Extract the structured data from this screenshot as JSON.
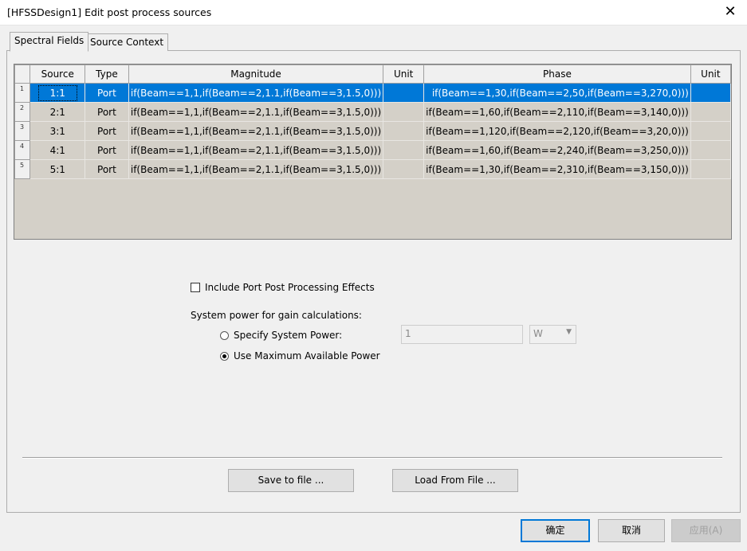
{
  "window": {
    "title": "[HFSSDesign1]  Edit post process sources",
    "close": "✕"
  },
  "tabs": [
    {
      "label": "Spectral Fields"
    },
    {
      "label": "Source Context"
    }
  ],
  "table": {
    "headers": [
      "Source",
      "Type",
      "Magnitude",
      "Unit",
      "Phase",
      "Unit"
    ],
    "selected_row": 0,
    "rows": [
      {
        "num": "1",
        "source": "1:1",
        "type": "Port",
        "magnitude": "if(Beam==1,1,if(Beam==2,1.1,if(Beam==3,1.5,0)))",
        "unit1": "",
        "phase": "if(Beam==1,30,if(Beam==2,50,if(Beam==3,270,0)))",
        "unit2": ""
      },
      {
        "num": "2",
        "source": "2:1",
        "type": "Port",
        "magnitude": "if(Beam==1,1,if(Beam==2,1.1,if(Beam==3,1.5,0)))",
        "unit1": "",
        "phase": "if(Beam==1,60,if(Beam==2,110,if(Beam==3,140,0)))",
        "unit2": ""
      },
      {
        "num": "3",
        "source": "3:1",
        "type": "Port",
        "magnitude": "if(Beam==1,1,if(Beam==2,1.1,if(Beam==3,1.5,0)))",
        "unit1": "",
        "phase": "if(Beam==1,120,if(Beam==2,120,if(Beam==3,20,0)))",
        "unit2": ""
      },
      {
        "num": "4",
        "source": "4:1",
        "type": "Port",
        "magnitude": "if(Beam==1,1,if(Beam==2,1.1,if(Beam==3,1.5,0)))",
        "unit1": "",
        "phase": "if(Beam==1,60,if(Beam==2,240,if(Beam==3,250,0)))",
        "unit2": ""
      },
      {
        "num": "5",
        "source": "5:1",
        "type": "Port",
        "magnitude": "if(Beam==1,1,if(Beam==2,1.1,if(Beam==3,1.5,0)))",
        "unit1": "",
        "phase": "if(Beam==1,30,if(Beam==2,310,if(Beam==3,150,0)))",
        "unit2": ""
      }
    ]
  },
  "options": {
    "include_effects": {
      "label": "Include Port Post Processing Effects",
      "checked": false
    },
    "power_label": "System power for gain calculations:",
    "specify": {
      "label": "Specify System Power:",
      "selected": false,
      "value": "1",
      "unit": "W"
    },
    "max_power": {
      "label": "Use Maximum Available Power",
      "selected": true
    }
  },
  "buttons": {
    "save": "Save to file ...",
    "load": "Load From File ...",
    "ok": "确定",
    "cancel": "取消",
    "apply": "应用(A)"
  },
  "colors": {
    "selection": "#0078d7",
    "grid_bg": "#d4d0c8"
  }
}
